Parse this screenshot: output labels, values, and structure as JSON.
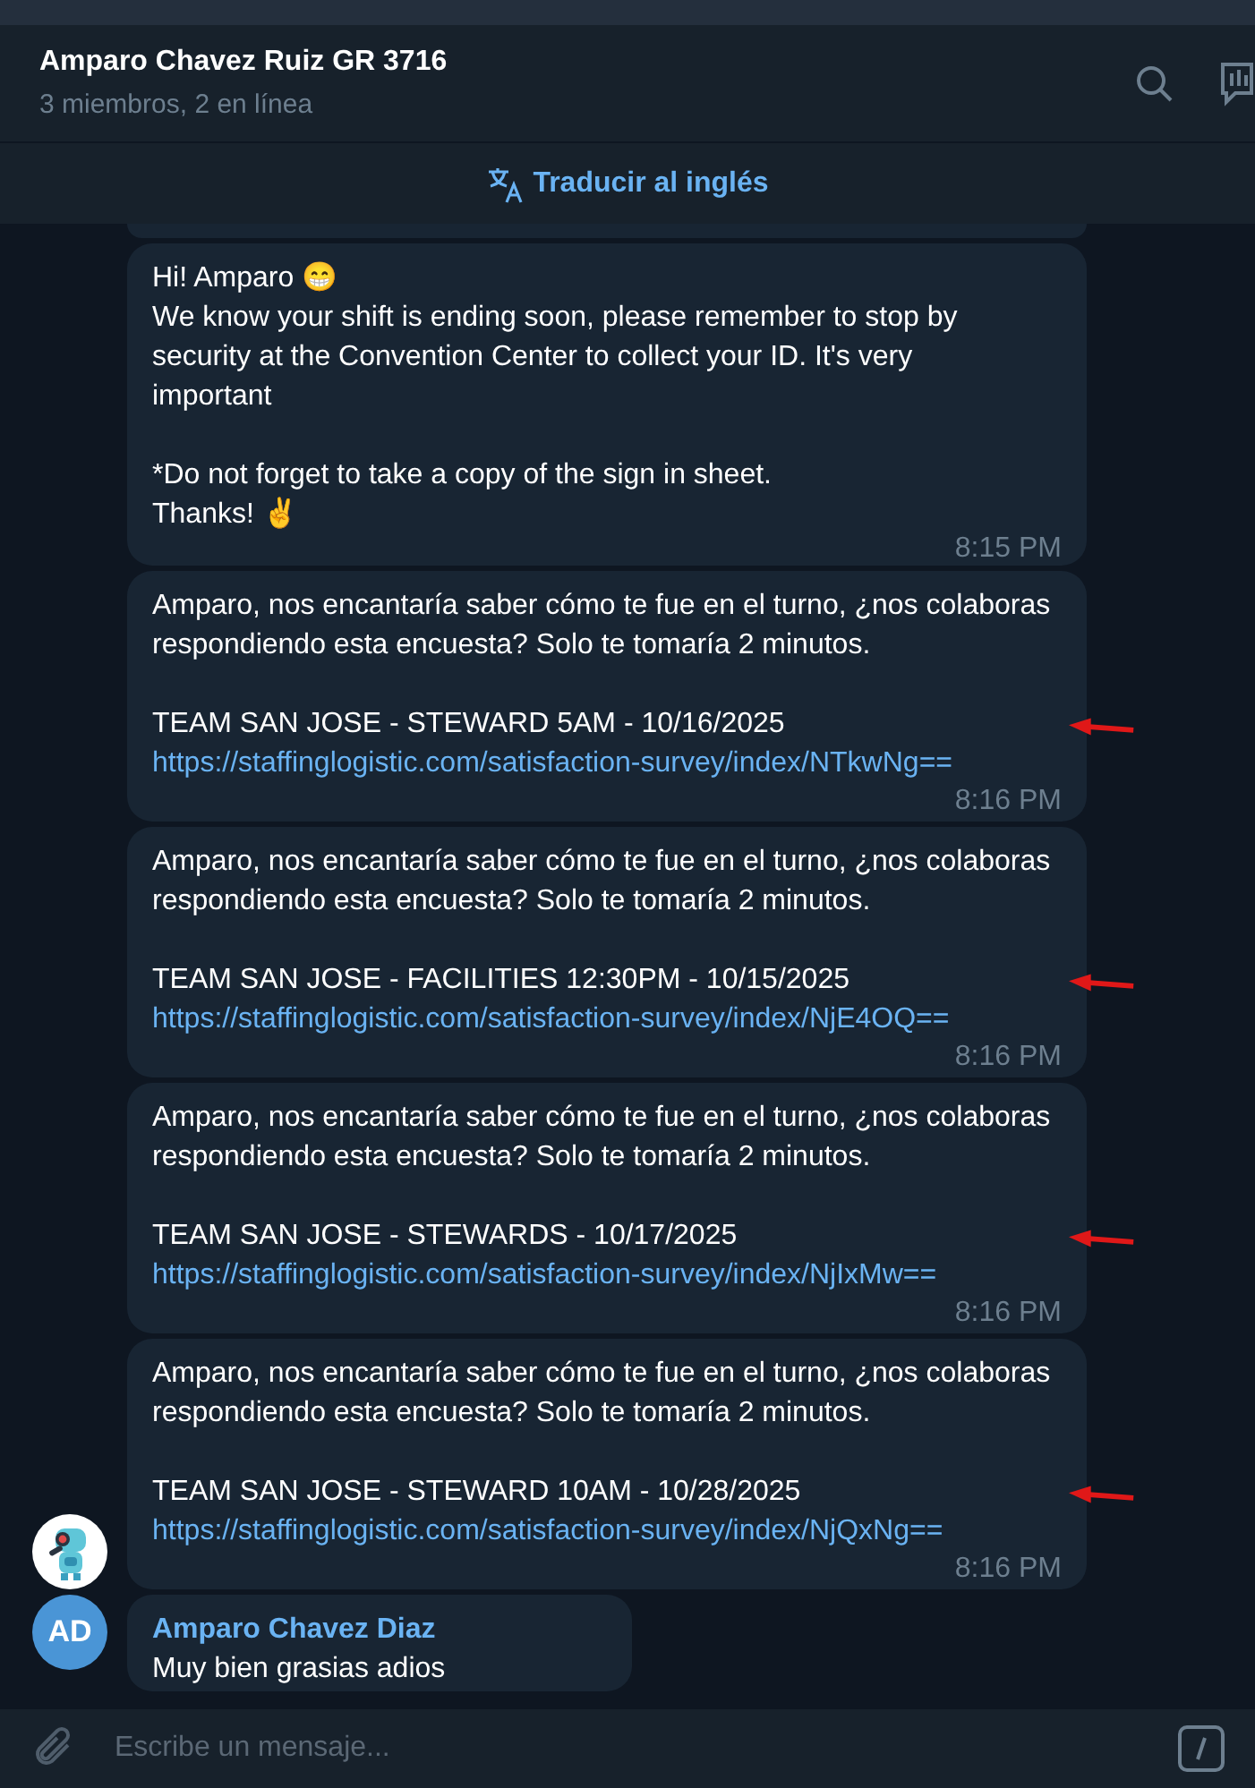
{
  "header": {
    "title": "Amparo Chavez Ruiz GR 3716",
    "subtitle": "3 miembros, 2 en línea"
  },
  "translate_bar": {
    "label": "Traducir al inglés"
  },
  "groups": [
    {
      "avatar": {
        "kind": "robot"
      },
      "messages": [
        {
          "kind": "text",
          "text": "Hi! Amparo 😁\nWe know your shift is ending soon, please remember to stop by security at the Convention Center to collect your ID. It's very important\n\n*Do not forget to take a copy of the sign in sheet.\nThanks! ✌️",
          "time": "8:15 PM",
          "annotated": false
        },
        {
          "kind": "survey",
          "text": "Amparo, nos encantaría saber cómo te fue en el turno, ¿nos colaboras respondiendo esta encuesta? Solo te tomaría 2 minutos.",
          "team": "TEAM SAN JOSE - STEWARD 5AM - 10/16/2025",
          "link": "https://staffinglogistic.com/satisfaction-survey/index/NTkwNg==",
          "time": "8:16 PM",
          "annotated": true
        },
        {
          "kind": "survey",
          "text": "Amparo, nos encantaría saber cómo te fue en el turno, ¿nos colaboras respondiendo esta encuesta? Solo te tomaría 2 minutos.",
          "team": "TEAM SAN JOSE - FACILITIES 12:30PM - 10/15/2025",
          "link": "https://staffinglogistic.com/satisfaction-survey/index/NjE4OQ==",
          "time": "8:16 PM",
          "annotated": true
        },
        {
          "kind": "survey",
          "text": "Amparo, nos encantaría saber cómo te fue en el turno, ¿nos colaboras respondiendo esta encuesta? Solo te tomaría 2 minutos.",
          "team": "TEAM SAN JOSE - STEWARDS - 10/17/2025",
          "link": "https://staffinglogistic.com/satisfaction-survey/index/NjIxMw==",
          "time": "8:16 PM",
          "annotated": true
        },
        {
          "kind": "survey",
          "text": "Amparo, nos encantaría saber cómo te fue en el turno, ¿nos colaboras respondiendo esta encuesta? Solo te tomaría 2 minutos.",
          "team": "TEAM SAN JOSE - STEWARD 10AM - 10/28/2025",
          "link": "https://staffinglogistic.com/satisfaction-survey/index/NjQxNg==",
          "time": "8:16 PM",
          "annotated": true
        }
      ]
    },
    {
      "avatar": {
        "kind": "initials",
        "initials": "AD",
        "color": "#4a95d6"
      },
      "sender": "Amparo Chavez Diaz",
      "messages": [
        {
          "kind": "short",
          "text": "Muy bien grasias adios",
          "annotated": false
        }
      ]
    }
  ],
  "composer": {
    "placeholder": "Escribe un mensaje..."
  }
}
